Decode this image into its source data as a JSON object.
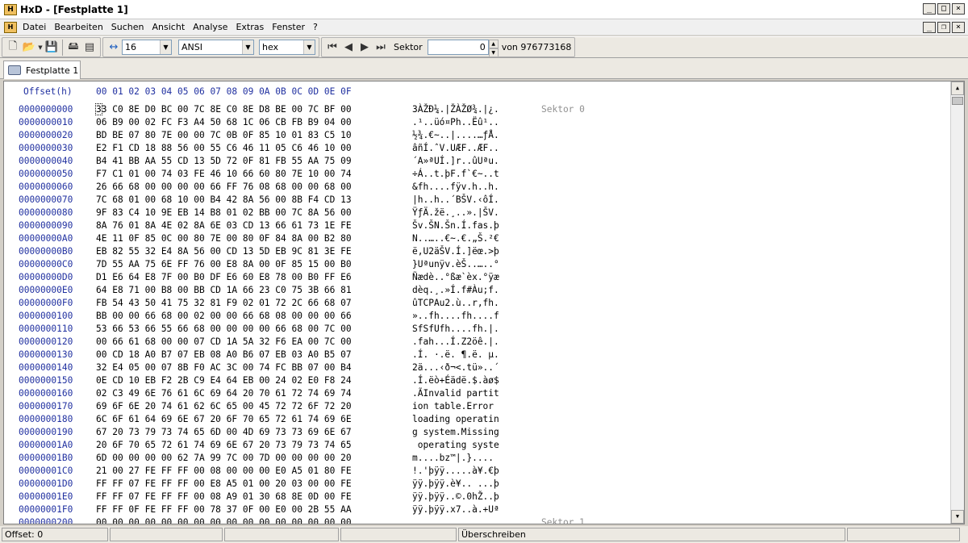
{
  "window": {
    "title": "HxD - [Festplatte 1]",
    "icon_text": "H"
  },
  "menu": {
    "items": [
      "Datei",
      "Bearbeiten",
      "Suchen",
      "Ansicht",
      "Analyse",
      "Extras",
      "Fenster",
      "?"
    ]
  },
  "toolbar": {
    "bytes_per_row": "16",
    "charset": "ANSI",
    "display_mode": "hex",
    "sector_label": "Sektor",
    "sector_value": "0",
    "sector_total": "von 976773168"
  },
  "tab": {
    "label": "Festplatte 1"
  },
  "editor": {
    "offset_header": "Offset(h)",
    "column_header": "00 01 02 03 04 05 06 07 08 09 0A 0B 0C 0D 0E 0F",
    "sector_labels": [
      "Sektor 0",
      "Sektor 1"
    ],
    "rows": [
      {
        "off": "0000000000",
        "hex": "33 C0 8E D0 BC 00 7C 8E C0 8E D8 BE 00 7C BF 00",
        "ascii": "3ÀŽĐ¼.|ŽÀŽØ¾.|¿."
      },
      {
        "off": "0000000010",
        "hex": "06 B9 00 02 FC F3 A4 50 68 1C 06 CB FB B9 04 00",
        "ascii": ".¹..üó¤Ph..Ëû¹.."
      },
      {
        "off": "0000000020",
        "hex": "BD BE 07 80 7E 00 00 7C 0B 0F 85 10 01 83 C5 10",
        "ascii": "½¾.€~..|....…ƒÅ."
      },
      {
        "off": "0000000030",
        "hex": "E2 F1 CD 18 88 56 00 55 C6 46 11 05 C6 46 10 00",
        "ascii": "âñÍ.ˆV.UÆF..ÆF.."
      },
      {
        "off": "0000000040",
        "hex": "B4 41 BB AA 55 CD 13 5D 72 0F 81 FB 55 AA 75 09",
        "ascii": "´A»ªUÍ.]r..ûUªu."
      },
      {
        "off": "0000000050",
        "hex": "F7 C1 01 00 74 03 FE 46 10 66 60 80 7E 10 00 74",
        "ascii": "÷Á..t.þF.f`€~..t"
      },
      {
        "off": "0000000060",
        "hex": "26 66 68 00 00 00 00 66 FF 76 08 68 00 00 68 00",
        "ascii": "&fh....fÿv.h..h."
      },
      {
        "off": "0000000070",
        "hex": "7C 68 01 00 68 10 00 B4 42 8A 56 00 8B F4 CD 13",
        "ascii": "|h..h..´BŠV.‹ôÍ."
      },
      {
        "off": "0000000080",
        "hex": "9F 83 C4 10 9E EB 14 B8 01 02 BB 00 7C 8A 56 00",
        "ascii": "ŸƒÄ.žë.¸..».|ŠV."
      },
      {
        "off": "0000000090",
        "hex": "8A 76 01 8A 4E 02 8A 6E 03 CD 13 66 61 73 1E FE",
        "ascii": "Šv.ŠN.Šn.Í.fas.þ"
      },
      {
        "off": "00000000A0",
        "hex": "4E 11 0F 85 0C 00 80 7E 00 80 0F 84 8A 00 B2 80",
        "ascii": "N..…..€~.€.„Š.²€"
      },
      {
        "off": "00000000B0",
        "hex": "EB 82 55 32 E4 8A 56 00 CD 13 5D EB 9C 81 3E FE",
        "ascii": "ë‚U2äŠV.Í.]ëœ.>þ"
      },
      {
        "off": "00000000C0",
        "hex": "7D 55 AA 75 6E FF 76 00 E8 8A 00 0F 85 15 00 B0",
        "ascii": "}Uªunÿv.èŠ..…..°"
      },
      {
        "off": "00000000D0",
        "hex": "D1 E6 64 E8 7F 00 B0 DF E6 60 E8 78 00 B0 FF E6",
        "ascii": "Ñædè..°ßæ`èx.°ÿæ"
      },
      {
        "off": "00000000E0",
        "hex": "64 E8 71 00 B8 00 BB CD 1A 66 23 C0 75 3B 66 81",
        "ascii": "dèq.¸.»Í.f#Àu;f."
      },
      {
        "off": "00000000F0",
        "hex": "FB 54 43 50 41 75 32 81 F9 02 01 72 2C 66 68 07",
        "ascii": "ûTCPAu2.ù..r,fh."
      },
      {
        "off": "0000000100",
        "hex": "BB 00 00 66 68 00 02 00 00 66 68 08 00 00 00 66",
        "ascii": "»..fh....fh....f"
      },
      {
        "off": "0000000110",
        "hex": "53 66 53 66 55 66 68 00 00 00 00 66 68 00 7C 00",
        "ascii": "SfSfUfh....fh.|."
      },
      {
        "off": "0000000120",
        "hex": "00 66 61 68 00 00 07 CD 1A 5A 32 F6 EA 00 7C 00",
        "ascii": ".fah...Í.Z2öê.|."
      },
      {
        "off": "0000000130",
        "hex": "00 CD 18 A0 B7 07 EB 08 A0 B6 07 EB 03 A0 B5 07",
        "ascii": ".Í. ·.ë. ¶.ë. µ."
      },
      {
        "off": "0000000140",
        "hex": "32 E4 05 00 07 8B F0 AC 3C 00 74 FC BB 07 00 B4",
        "ascii": "2ä...‹ð¬<.tü»..´"
      },
      {
        "off": "0000000150",
        "hex": "0E CD 10 EB F2 2B C9 E4 64 EB 00 24 02 E0 F8 24",
        "ascii": ".Í.ëò+Éädë.$.àø$"
      },
      {
        "off": "0000000160",
        "hex": "02 C3 49 6E 76 61 6C 69 64 20 70 61 72 74 69 74",
        "ascii": ".ÃInvalid partit"
      },
      {
        "off": "0000000170",
        "hex": "69 6F 6E 20 74 61 62 6C 65 00 45 72 72 6F 72 20",
        "ascii": "ion table.Error "
      },
      {
        "off": "0000000180",
        "hex": "6C 6F 61 64 69 6E 67 20 6F 70 65 72 61 74 69 6E",
        "ascii": "loading operatin"
      },
      {
        "off": "0000000190",
        "hex": "67 20 73 79 73 74 65 6D 00 4D 69 73 73 69 6E 67",
        "ascii": "g system.Missing"
      },
      {
        "off": "00000001A0",
        "hex": "20 6F 70 65 72 61 74 69 6E 67 20 73 79 73 74 65",
        "ascii": " operating syste"
      },
      {
        "off": "00000001B0",
        "hex": "6D 00 00 00 00 62 7A 99 7C 00 7D 00 00 00 00 20",
        "ascii": "m....bz™|.}.... "
      },
      {
        "off": "00000001C0",
        "hex": "21 00 27 FE FF FF 00 08 00 00 00 E0 A5 01 80 FE",
        "ascii": "!.'þÿÿ.....à¥.€þ"
      },
      {
        "off": "00000001D0",
        "hex": "FF FF 07 FE FF FF 00 E8 A5 01 00 20 03 00 00 FE",
        "ascii": "ÿÿ.þÿÿ.è¥.. ...þ"
      },
      {
        "off": "00000001E0",
        "hex": "FF FF 07 FE FF FF 00 08 A9 01 30 68 8E 0D 00 FE",
        "ascii": "ÿÿ.þÿÿ..©.0hŽ..þ"
      },
      {
        "off": "00000001F0",
        "hex": "FF FF 0F FE FF FF 00 78 37 0F 00 E0 00 2B 55 AA",
        "ascii": "ÿÿ.þÿÿ.x7..à.+Uª"
      },
      {
        "off": "0000000200",
        "hex": "00 00 00 00 00 00 00 00 00 00 00 00 00 00 00 00",
        "ascii": "................"
      }
    ]
  },
  "status": {
    "offset": "Offset: 0",
    "mode": "Überschreiben"
  }
}
